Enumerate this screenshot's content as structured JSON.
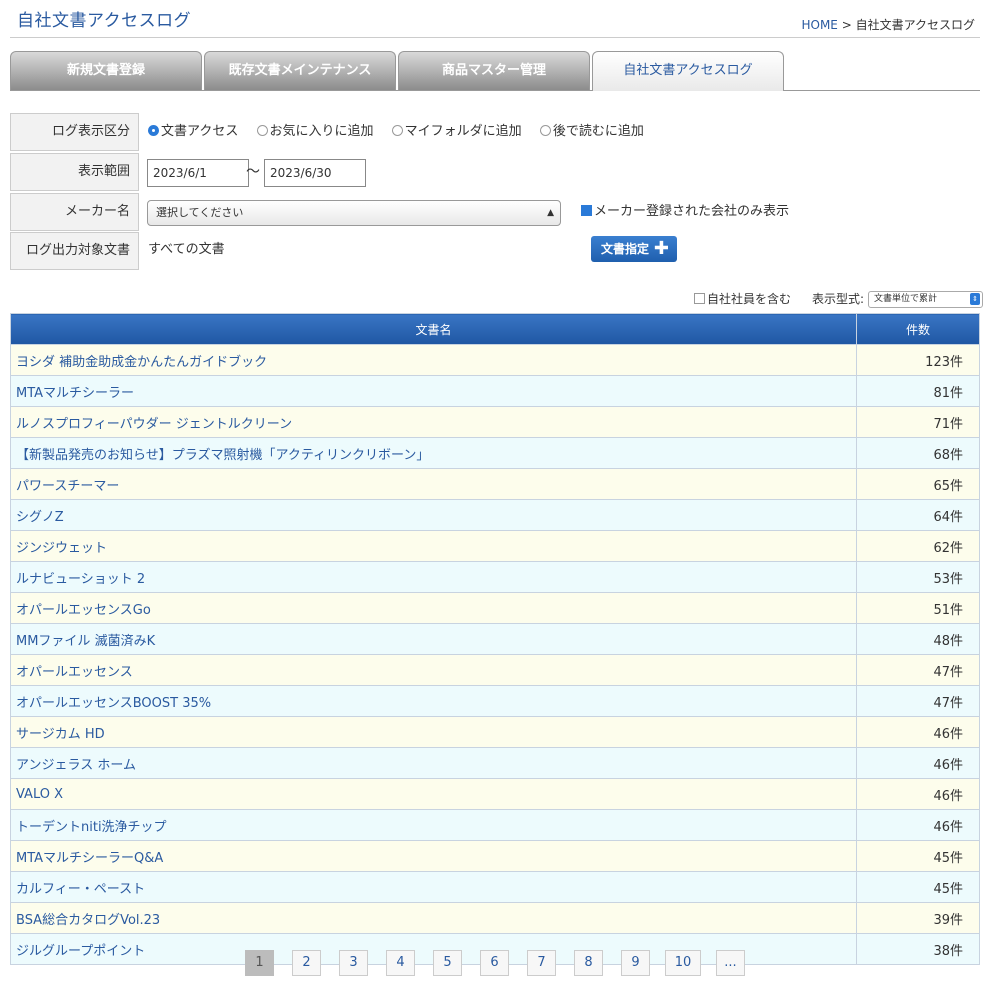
{
  "header": {
    "title": "自社文書アクセスログ",
    "breadcrumb_home": "HOME",
    "breadcrumb_sep": ">",
    "breadcrumb_current": "自社文書アクセスログ"
  },
  "tabs": [
    {
      "label": "新規文書登録"
    },
    {
      "label": "既存文書メインテナンス"
    },
    {
      "label": "商品マスター管理"
    },
    {
      "label": "自社文書アクセスログ"
    }
  ],
  "form": {
    "log_type_label": "ログ表示区分",
    "log_type_options": [
      "文書アクセス",
      "お気に入りに追加",
      "マイフォルダに追加",
      "後で読むに追加"
    ],
    "log_type_selected": "文書アクセス",
    "range_label": "表示範囲",
    "date_from": "2023/6/1",
    "tilde": "〜",
    "date_to": "2023/6/30",
    "maker_label": "メーカー名",
    "maker_select": "選択してください",
    "maker_only_label": "メーカー登録された会社のみ表示",
    "target_label": "ログ出力対象文書",
    "target_value": "すべての文書",
    "doc_button": "文書指定"
  },
  "options": {
    "include_staff": "自社社員を含む",
    "format_label": "表示型式:",
    "format_value": "文書単位で累計"
  },
  "table": {
    "col_name": "文書名",
    "col_count": "件数",
    "rows": [
      {
        "name": "ヨシダ 補助金助成金かんたんガイドブック",
        "count": "123件"
      },
      {
        "name": "MTAマルチシーラー",
        "count": "81件"
      },
      {
        "name": "ルノスプロフィーパウダー ジェントルクリーン",
        "count": "71件"
      },
      {
        "name": "【新製品発売のお知らせ】プラズマ照射機「アクティリンクリボーン」",
        "count": "68件"
      },
      {
        "name": "パワースチーマー",
        "count": "65件"
      },
      {
        "name": "シグノZ",
        "count": "64件"
      },
      {
        "name": "ジンジウェット",
        "count": "62件"
      },
      {
        "name": "ルナビューショット 2",
        "count": "53件"
      },
      {
        "name": "オパールエッセンスGo",
        "count": "51件"
      },
      {
        "name": "MMファイル 滅菌済みK",
        "count": "48件"
      },
      {
        "name": "オパールエッセンス",
        "count": "47件"
      },
      {
        "name": "オパールエッセンスBOOST 35%",
        "count": "47件"
      },
      {
        "name": "サージカム HD",
        "count": "46件"
      },
      {
        "name": "アンジェラス ホーム",
        "count": "46件"
      },
      {
        "name": "VALO X",
        "count": "46件"
      },
      {
        "name": "トーデントniti洗浄チップ",
        "count": "46件"
      },
      {
        "name": "MTAマルチシーラーQ&A",
        "count": "45件"
      },
      {
        "name": "カルフィー・ペースト",
        "count": "45件"
      },
      {
        "name": "BSA総合カタログVol.23",
        "count": "39件"
      },
      {
        "name": "ジルグループポイント",
        "count": "38件"
      }
    ]
  },
  "pager": [
    "1",
    "2",
    "3",
    "4",
    "5",
    "6",
    "7",
    "8",
    "9",
    "10",
    "..."
  ]
}
